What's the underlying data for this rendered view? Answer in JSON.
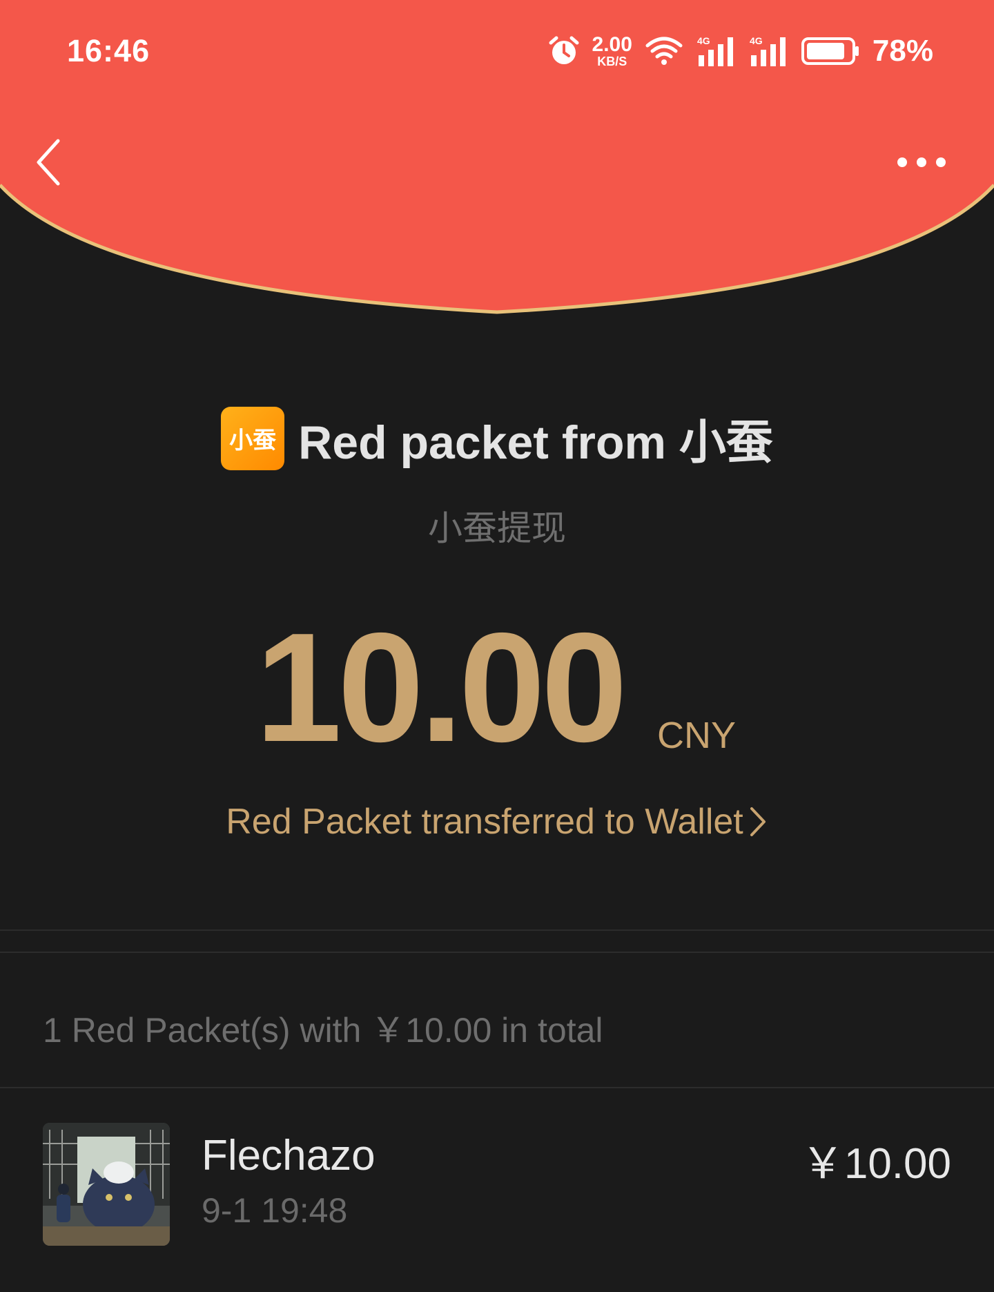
{
  "status_bar": {
    "time": "16:46",
    "net_speed_value": "2.00",
    "net_speed_unit": "KB/S",
    "battery_percent": "78%"
  },
  "icons": {
    "alarm": "alarm-icon",
    "wifi": "wifi-icon",
    "signal_1": "signal-4g-icon",
    "signal_2": "signal-4g-icon",
    "battery": "battery-icon",
    "back": "chevron-left-icon",
    "more": "more-dots-icon",
    "wallet_arrow": "chevron-right-icon"
  },
  "colors": {
    "header_red": "#f4574a",
    "gold": "#c9a470",
    "background": "#1b1b1b"
  },
  "packet": {
    "logo_text": "小蚕",
    "title": "Red packet from 小蚕",
    "subtitle": "小蚕提现",
    "amount": "10.00",
    "currency": "CNY",
    "wallet_link": "Red Packet transferred to Wallet"
  },
  "summary": {
    "text": "1 Red Packet(s) with ￥10.00 in total"
  },
  "records": [
    {
      "name": "Flechazo",
      "time": "9-1 19:48",
      "amount": "￥10.00"
    }
  ]
}
